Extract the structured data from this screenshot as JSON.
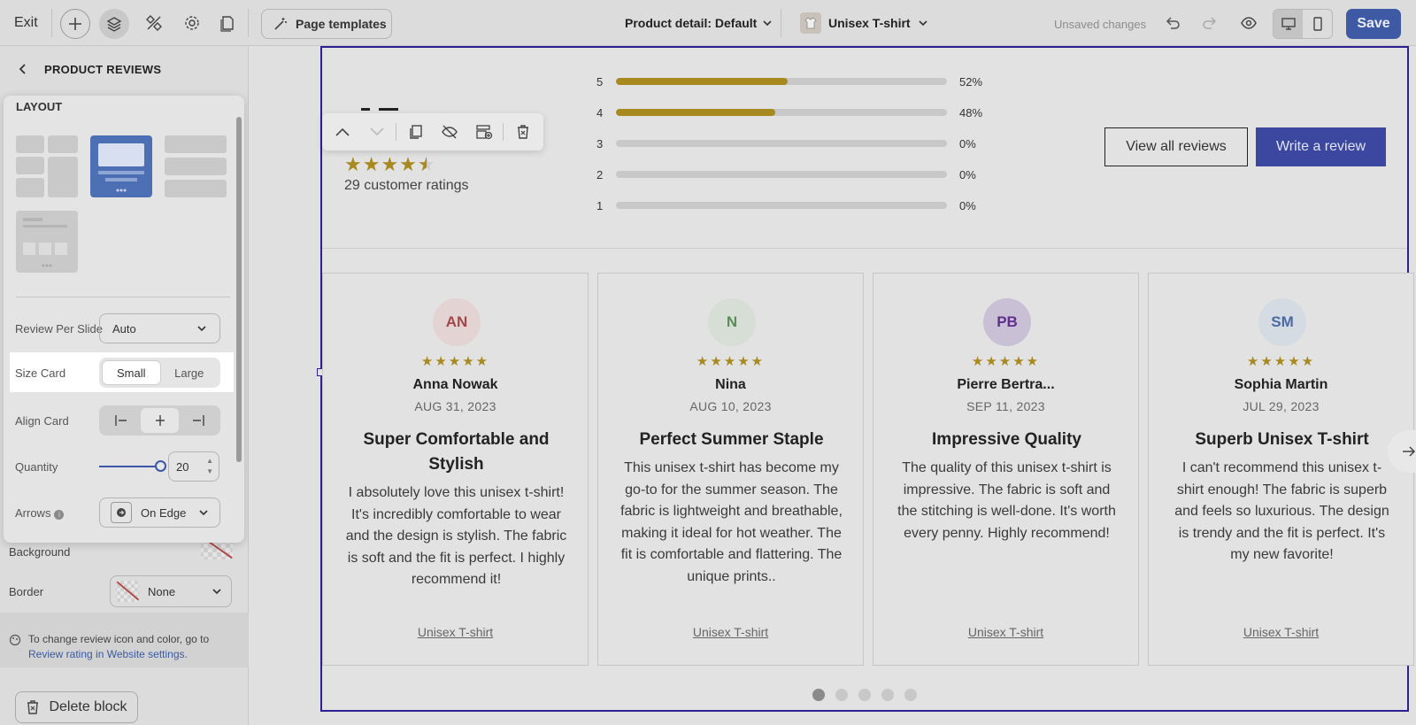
{
  "topbar": {
    "exit": "Exit",
    "page_templates": "Page templates",
    "page_selector": "Product detail: Default",
    "product_selector": "Unisex T-shirt",
    "unsaved": "Unsaved changes",
    "save": "Save"
  },
  "sidebar": {
    "title": "PRODUCT REVIEWS",
    "background_label": "Background",
    "border_label": "Border",
    "border_value": "None",
    "note_text": "To change review icon and color, go to",
    "note_link": "Review rating in Website settings.",
    "delete_block": "Delete block"
  },
  "layout_popover": {
    "title": "LAYOUT",
    "review_per_slide_label": "Review Per Slide",
    "review_per_slide_value": "Auto",
    "size_card_label": "Size Card",
    "size_options": [
      "Small",
      "Large"
    ],
    "size_selected": "Small",
    "align_card_label": "Align Card",
    "align_selected": "center",
    "quantity_label": "Quantity",
    "quantity_value": "20",
    "quantity_slider_fraction": 0.2,
    "arrows_label": "Arrows",
    "arrows_value": "On Edge",
    "selected_layout": "carousel"
  },
  "summary": {
    "average_stars": 4.5,
    "customer_ratings": "29 customer ratings",
    "distribution": [
      {
        "stars": "5",
        "percent": "52%",
        "fraction": 0.52
      },
      {
        "stars": "4",
        "percent": "48%",
        "fraction": 0.48
      },
      {
        "stars": "3",
        "percent": "0%",
        "fraction": 0
      },
      {
        "stars": "2",
        "percent": "0%",
        "fraction": 0
      },
      {
        "stars": "1",
        "percent": "0%",
        "fraction": 0
      }
    ],
    "view_all": "View all reviews",
    "write_review": "Write a review"
  },
  "reviews": [
    {
      "initials": "AN",
      "avatar_bg": "#e3d3d3",
      "avatar_color": "#a34848",
      "stars": "★★★★★",
      "name": "Anna Nowak",
      "date": "AUG 31, 2023",
      "title": "Super Comfortable and Stylish",
      "body": "I absolutely love this unisex t-shirt! It's incredibly comfortable to wear and the design is stylish. The fabric is soft and the fit is perfect. I highly recommend it!",
      "product": "Unisex T-shirt"
    },
    {
      "initials": "N",
      "avatar_bg": "#d6ded5",
      "avatar_color": "#5b8d58",
      "stars": "★★★★★",
      "name": "Nina",
      "date": "AUG 10, 2023",
      "title": "Perfect Summer Staple",
      "body": "This unisex t-shirt has become my go-to for the summer season. The fabric is lightweight and breathable, making it ideal for hot weather. The fit is comfortable and flattering. The unique prints..",
      "product": "Unisex T-shirt"
    },
    {
      "initials": "PB",
      "avatar_bg": "#c9c0d6",
      "avatar_color": "#5e2f8c",
      "stars": "★★★★★",
      "name": "Pierre Bertra...",
      "date": "SEP 11, 2023",
      "title": "Impressive Quality",
      "body": "The quality of this unisex t-shirt is impressive. The fabric is soft and the stitching is well-done. It's worth every penny. Highly recommend!",
      "product": "Unisex T-shirt"
    },
    {
      "initials": "SM",
      "avatar_bg": "#d5dbe3",
      "avatar_color": "#4a6aa0",
      "stars": "★★★★★",
      "name": "Sophia Martin",
      "date": "JUL 29, 2023",
      "title": "Superb Unisex T-shirt",
      "body": "I can't recommend this unisex t-shirt enough! The fabric is superb and feels so luxurious. The design is trendy and the fit is perfect. It's my new favorite!",
      "product": "Unisex T-shirt"
    }
  ],
  "pagination": {
    "count": 5,
    "active": 1
  },
  "colors": {
    "accent": "#3f5aa5",
    "star": "#a7891f",
    "selection": "#2b2190",
    "write_button": "#3c48a0"
  }
}
